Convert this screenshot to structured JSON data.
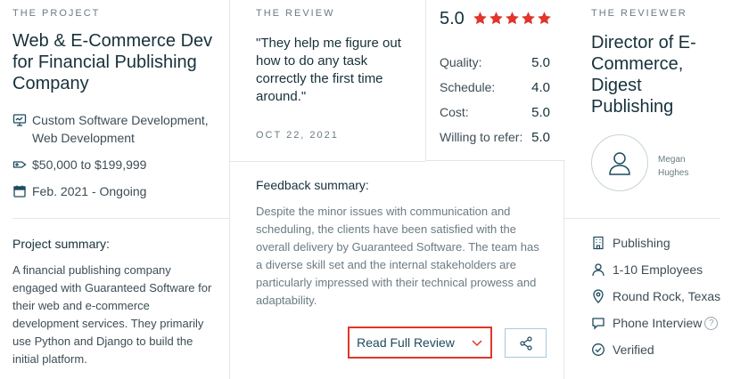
{
  "project": {
    "eyebrow": "THE PROJECT",
    "title": "Web & E-Commerce Dev for Financial Publishing Company",
    "services": "Custom Software Development, Web Development",
    "budget": "$50,000 to $199,999",
    "timeline": "Feb. 2021 - Ongoing",
    "summary_label": "Project summary:",
    "summary_text": "A financial publishing company engaged with Guaranteed Software for their web and e-commerce development services. They primarily use Python and Django to build the initial platform."
  },
  "review": {
    "eyebrow": "THE REVIEW",
    "quote": "\"They help me figure out how to do any task correctly the first time around.\"",
    "date": "OCT 22, 2021",
    "overall": "5.0",
    "stars": 5,
    "ratings": [
      {
        "label": "Quality:",
        "value": "5.0"
      },
      {
        "label": "Schedule:",
        "value": "4.0"
      },
      {
        "label": "Cost:",
        "value": "5.0"
      },
      {
        "label": "Willing to refer:",
        "value": "5.0"
      }
    ],
    "feedback_label": "Feedback summary:",
    "feedback_text": "Despite the minor issues with communication and scheduling, the clients have been satisfied with the overall delivery by Guaranteed Software. The team has a diverse skill set and the internal stakeholders are particularly impressed with their technical prowess and adaptability.",
    "read_button": "Read Full Review"
  },
  "reviewer": {
    "eyebrow": "THE REVIEWER",
    "title": "Director of E-Commerce, Digest Publishing",
    "name": "Megan Hughes",
    "industry": "Publishing",
    "employees": "1-10 Employees",
    "location": "Round Rock, Texas",
    "interview": "Phone Interview",
    "help": "?",
    "verified": "Verified"
  },
  "colors": {
    "star": "#e0362b",
    "button_border": "#e0362b",
    "icon": "#1d4a5e"
  },
  "icons": [
    "monitor-icon",
    "tag-icon",
    "calendar-icon",
    "star-icon",
    "chevron-down-icon",
    "share-icon",
    "user-icon",
    "building-icon",
    "location-pin-icon",
    "chat-bubble-icon",
    "check-circle-icon"
  ]
}
